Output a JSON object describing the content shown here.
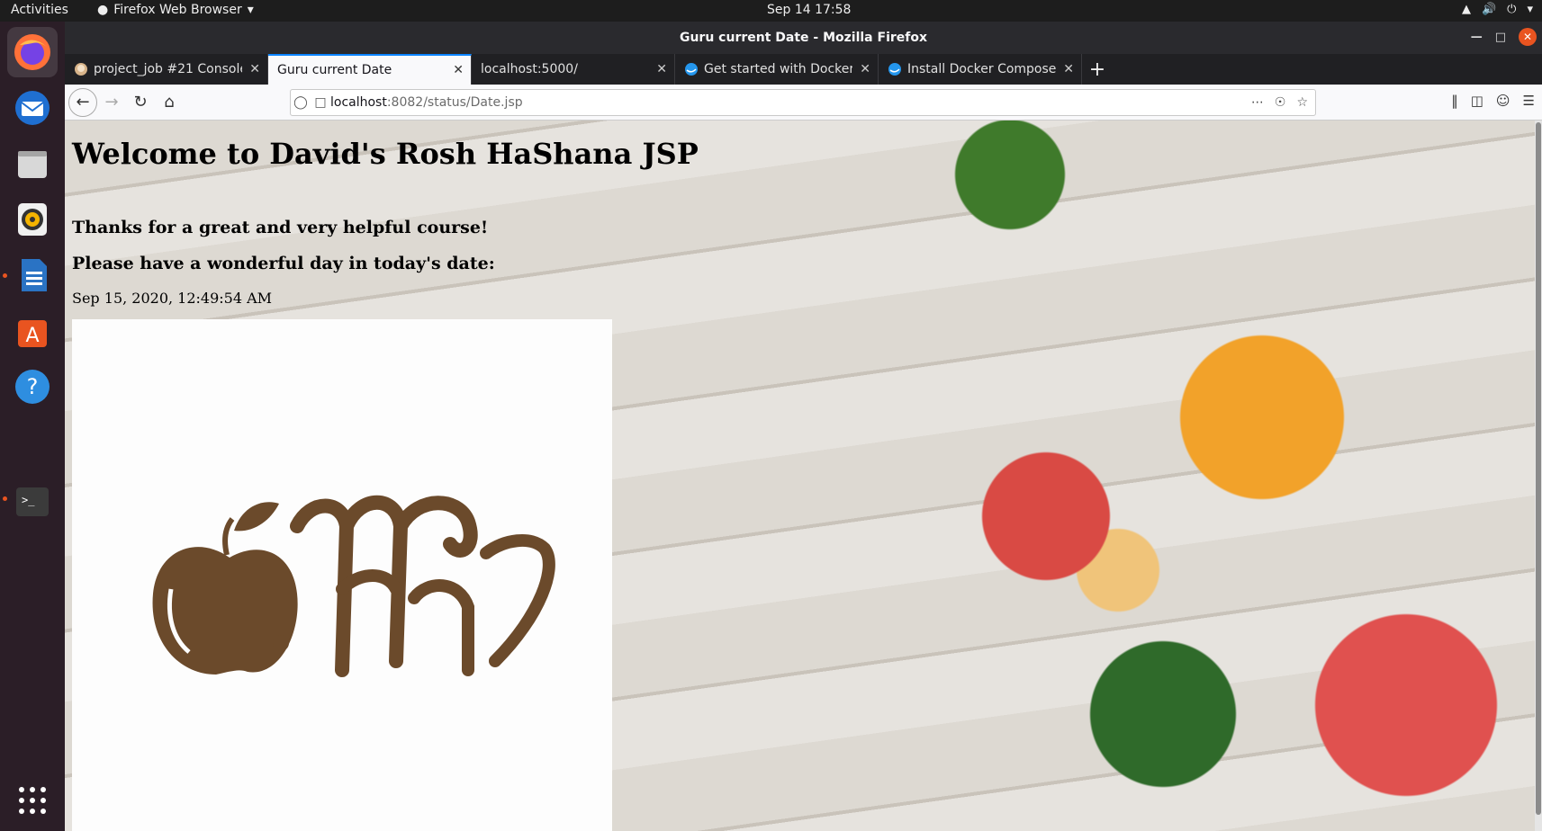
{
  "topbar": {
    "activities": "Activities",
    "app_menu": "Firefox Web Browser",
    "clock": "Sep 14  17:58"
  },
  "dock": {
    "items": [
      "firefox",
      "thunderbird",
      "files",
      "rhythmbox",
      "libreoffice-writer",
      "ubuntu-software",
      "help",
      "terminal",
      "show-applications"
    ]
  },
  "window": {
    "title": "Guru current Date - Mozilla Firefox"
  },
  "tabs": [
    {
      "label": "project_job #21 Console",
      "selected": false
    },
    {
      "label": "Guru current Date",
      "selected": true
    },
    {
      "label": "localhost:5000/",
      "selected": false
    },
    {
      "label": "Get started with Docker",
      "selected": false
    },
    {
      "label": "Install Docker Compose",
      "selected": false
    }
  ],
  "urlbar": {
    "host": "localhost",
    "path": ":8082/status/Date.jsp"
  },
  "page": {
    "heading": "Welcome to David's Rosh HaShana JSP",
    "line1": "Thanks for a great and very helpful course!",
    "line2": "Please have a wonderful day in today's date:",
    "date": "Sep 15, 2020, 12:49:54 AM"
  },
  "colors": {
    "accent": "#0a84ff",
    "ubuntu_orange": "#e95420",
    "card_brown": "#6b4a2b"
  }
}
